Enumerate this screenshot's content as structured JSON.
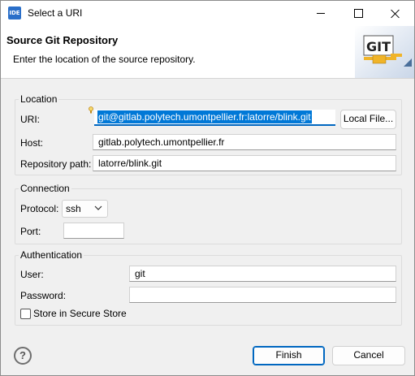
{
  "window": {
    "title": "Select a URI",
    "app_icon_text": "IDE"
  },
  "banner": {
    "title": "Source Git Repository",
    "description": "Enter the location of the source repository.",
    "logo_text": "GIT"
  },
  "location": {
    "group_label": "Location",
    "uri_label": "URI:",
    "uri_value": "git@gitlab.polytech.umontpellier.fr:latorre/blink.git",
    "local_file_button": "Local File...",
    "host_label": "Host:",
    "host_value": "gitlab.polytech.umontpellier.fr",
    "repo_path_label": "Repository path:",
    "repo_path_value": "latorre/blink.git"
  },
  "connection": {
    "group_label": "Connection",
    "protocol_label": "Protocol:",
    "protocol_value": "ssh",
    "port_label": "Port:",
    "port_value": ""
  },
  "authentication": {
    "group_label": "Authentication",
    "user_label": "User:",
    "user_value": "git",
    "password_label": "Password:",
    "password_value": "",
    "secure_store_label": "Store in Secure Store",
    "secure_store_checked": false
  },
  "footer": {
    "help_glyph": "?",
    "finish_button": "Finish",
    "cancel_button": "Cancel"
  },
  "colors": {
    "accent": "#0067c0",
    "selection": "#0078d7"
  }
}
